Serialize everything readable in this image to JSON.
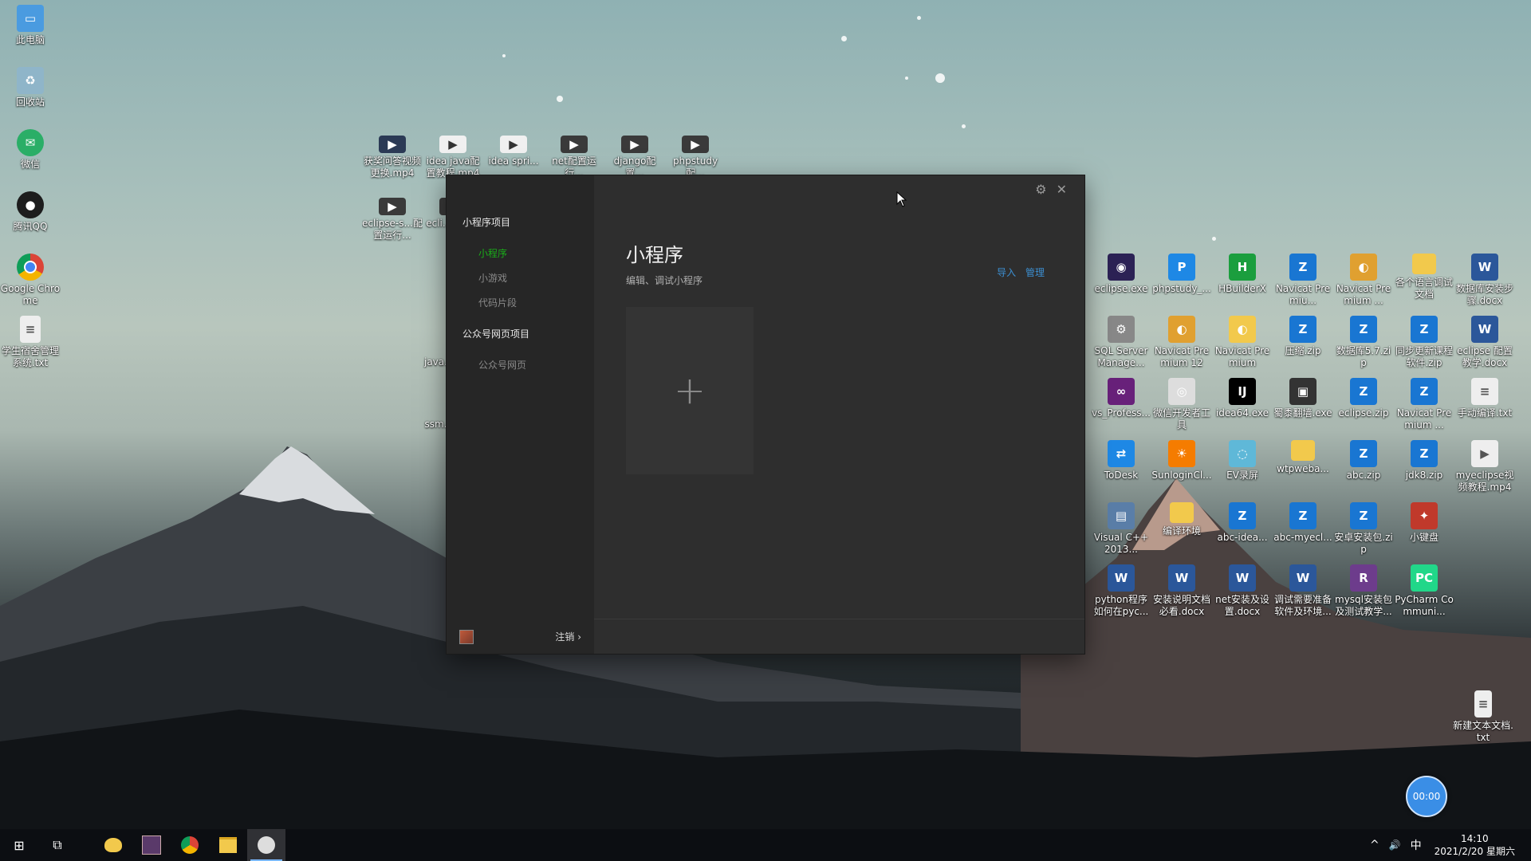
{
  "desktop": {
    "left_icons": [
      {
        "label": "此电脑",
        "icon": "computer-icon",
        "color": "#4a9be0"
      },
      {
        "label": "回收站",
        "icon": "recycle-bin-icon",
        "color": "#8fb5c9"
      },
      {
        "label": "微信",
        "icon": "wechat-icon",
        "color": "#2aae67"
      },
      {
        "label": "腾讯QQ",
        "icon": "qq-icon",
        "color": "#1d1d1d"
      },
      {
        "label": "Google Chrome",
        "icon": "chrome-icon",
        "color": "#db4437"
      },
      {
        "label": "学生宿舍管理系统.txt",
        "icon": "text-file-icon",
        "color": "#eeeeee"
      }
    ],
    "middle_icons_row1": [
      {
        "label": "获奖问答视频更换.mp4",
        "icon": "video-file-icon",
        "color": "#2b3a55"
      },
      {
        "label": "idea java配置教程.mp4",
        "icon": "video-file-icon",
        "color": "#f0f0f0"
      },
      {
        "label": "idea spri...",
        "icon": "video-file-icon",
        "color": "#f0f0f0"
      },
      {
        "label": "net配置运行...",
        "icon": "video-file-icon",
        "color": "#3a3a3a"
      },
      {
        "label": "django配置...",
        "icon": "video-file-icon",
        "color": "#3a3a3a"
      },
      {
        "label": "phpstudy配...",
        "icon": "video-file-icon",
        "color": "#3a3a3a"
      }
    ],
    "middle_icons_row2": [
      {
        "label": "eclipse-s...配置运行...",
        "icon": "video-file-icon",
        "color": "#3a3a3a"
      },
      {
        "label": "ecli...配置...",
        "icon": "video-file-icon",
        "color": "#3a3a3a"
      }
    ],
    "middle_icons_col": [
      {
        "label": "java...作品...",
        "icon": "file-icon",
        "color": "#555555"
      },
      {
        "label": "ssm...控区...",
        "icon": "file-icon",
        "color": "#555555"
      }
    ],
    "right_icons": [
      [
        {
          "label": "eclipse.exe",
          "icon": "eclipse-icon",
          "color": "#2c2255"
        },
        {
          "label": "phpstudy_...",
          "icon": "phpstudy-icon",
          "color": "#1e88e5"
        },
        {
          "label": "HBuilderX",
          "icon": "hbuilder-icon",
          "color": "#1b9e3e"
        },
        {
          "label": "Navicat Premiu...",
          "icon": "zip-icon",
          "color": "#1976d2"
        },
        {
          "label": "Navicat Premium ...",
          "icon": "navicat-icon",
          "color": "#e0a030"
        },
        {
          "label": "各个语言调试文档",
          "icon": "folder-icon",
          "color": "#f2c94c"
        },
        {
          "label": "数据库安装步骤.docx",
          "icon": "word-doc-icon",
          "color": "#2b579a"
        }
      ],
      [
        {
          "label": "SQL Server Manage...",
          "icon": "sql-server-icon",
          "color": "#888888"
        },
        {
          "label": "Navicat Premium 12",
          "icon": "navicat-icon",
          "color": "#e0a030"
        },
        {
          "label": "Navicat Premium",
          "icon": "navicat-icon",
          "color": "#f2c94c"
        },
        {
          "label": "压缩.zip",
          "icon": "zip-icon",
          "color": "#1976d2"
        },
        {
          "label": "数据库5.7.zip",
          "icon": "zip-icon",
          "color": "#1976d2"
        },
        {
          "label": "同步更新课程软件.zip",
          "icon": "zip-icon",
          "color": "#1976d2"
        },
        {
          "label": "eclipse 配置教学.docx",
          "icon": "word-doc-icon",
          "color": "#2b579a"
        }
      ],
      [
        {
          "label": "vs_Profess...",
          "icon": "visual-studio-icon",
          "color": "#68217a"
        },
        {
          "label": "微信开发者工具",
          "icon": "wechat-devtools-icon",
          "color": "#dddddd"
        },
        {
          "label": "idea64.exe",
          "icon": "intellij-icon",
          "color": "#000000"
        },
        {
          "label": "蜀黍翻墙.exe",
          "icon": "exe-icon",
          "color": "#333333"
        },
        {
          "label": "eclipse.zip",
          "icon": "zip-icon",
          "color": "#1976d2"
        },
        {
          "label": "Navicat Premium ...",
          "icon": "zip-icon",
          "color": "#1976d2"
        },
        {
          "label": "手动编译.txt",
          "icon": "text-file-icon",
          "color": "#eeeeee"
        }
      ],
      [
        {
          "label": "ToDesk",
          "icon": "todesk-icon",
          "color": "#1e88e5"
        },
        {
          "label": "SunloginCl...",
          "icon": "sunlogin-icon",
          "color": "#f57c00"
        },
        {
          "label": "EV录屏",
          "icon": "ev-recorder-icon",
          "color": "#5fb8d8"
        },
        {
          "label": "wtpweba...",
          "icon": "folder-icon",
          "color": "#f2c94c"
        },
        {
          "label": "abc.zip",
          "icon": "zip-icon",
          "color": "#1976d2"
        },
        {
          "label": "jdk8.zip",
          "icon": "zip-icon",
          "color": "#1976d2"
        },
        {
          "label": "myeclipse视频教程.mp4",
          "icon": "video-file-icon",
          "color": "#eeeeee"
        }
      ],
      [
        {
          "label": "Visual C++ 2013...",
          "icon": "installer-icon",
          "color": "#5a7ea8"
        },
        {
          "label": "编译环境",
          "icon": "folder-icon",
          "color": "#f2c94c"
        },
        {
          "label": "abc-idea...",
          "icon": "zip-icon",
          "color": "#1976d2"
        },
        {
          "label": "abc-myecl...",
          "icon": "zip-icon",
          "color": "#1976d2"
        },
        {
          "label": "安卓安装包.zip",
          "icon": "zip-icon",
          "color": "#1976d2"
        },
        {
          "label": "小键盘",
          "icon": "app-icon",
          "color": "#c0392b"
        }
      ],
      [
        {
          "label": "python程序如何在pyc...",
          "icon": "word-doc-icon",
          "color": "#2b579a"
        },
        {
          "label": "安装说明文档必看.docx",
          "icon": "word-doc-icon",
          "color": "#2b579a"
        },
        {
          "label": "net安装及设置.docx",
          "icon": "word-doc-icon",
          "color": "#2b579a"
        },
        {
          "label": "调试需要准备软件及环境...",
          "icon": "word-doc-icon",
          "color": "#2b579a"
        },
        {
          "label": "mysql安装包及测试教学...",
          "icon": "rar-icon",
          "color": "#6d3c8c"
        },
        {
          "label": "PyCharm Communi...",
          "icon": "pycharm-icon",
          "color": "#21d789"
        }
      ]
    ],
    "bottom_right_icon": {
      "label": "新建文本文档.txt",
      "icon": "text-file-icon",
      "color": "#eeeeee"
    }
  },
  "devtools": {
    "sidebar": {
      "section1_title": "小程序项目",
      "items1": [
        "小程序",
        "小游戏",
        "代码片段"
      ],
      "section2_title": "公众号网页项目",
      "items2": [
        "公众号网页"
      ],
      "logout_label": "注销 ›"
    },
    "main": {
      "title": "小程序",
      "subtitle": "编辑、调试小程序",
      "import_label": "导入",
      "manage_label": "管理",
      "add_symbol": "+"
    },
    "controls": {
      "settings_glyph": "⚙",
      "close_glyph": "✕"
    },
    "accent_color": "#1aad19"
  },
  "taskbar": {
    "start_glyph": "⊞",
    "taskview_glyph": "⧉",
    "tray": {
      "chevron": "^",
      "volume": "🔊",
      "ime": "中",
      "time": "14:10",
      "date": "2021/2/20 星期六"
    }
  },
  "recorder": {
    "time": "00:00"
  }
}
